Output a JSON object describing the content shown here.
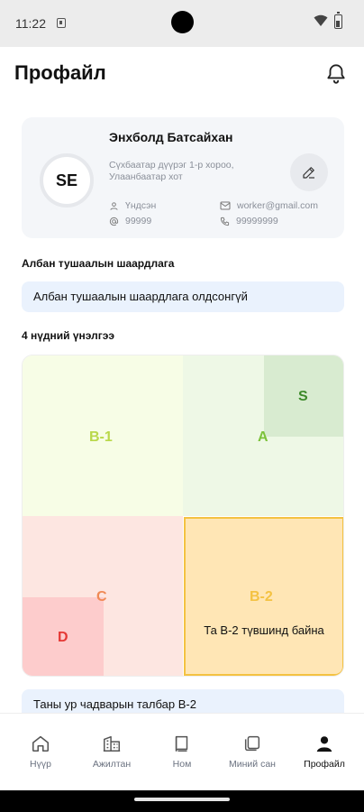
{
  "status_bar": {
    "time": "11:22"
  },
  "header": {
    "title": "Профайл"
  },
  "profile": {
    "initials": "SE",
    "name": "Энхболд Батсайхан",
    "address": "Сүхбаатар дүүрэг 1-р хороо, Улаанбаатар хот",
    "status": "Үндсэн",
    "email": "worker@gmail.com",
    "id_number": "99999",
    "phone": "99999999"
  },
  "requirements": {
    "title": "Албан тушаалын шаардлага",
    "empty_text": "Албан тушаалын шаардлага олдсонгүй"
  },
  "assessment": {
    "title": "4 нүдний үнэлгээ",
    "quadrants": {
      "b1": {
        "label": "B-1",
        "color": "#b9d84a"
      },
      "a": {
        "label": "A",
        "color": "#7cc23a"
      },
      "s": {
        "label": "S",
        "color": "#3d8a2a"
      },
      "c": {
        "label": "C",
        "color": "#f08a55"
      },
      "d": {
        "label": "D",
        "color": "#e53935"
      },
      "b2": {
        "label": "B-2",
        "color": "#f4c242"
      }
    },
    "current_text": "Та B-2 түвшинд байна"
  },
  "zone_text": "Таны ур чадварын талбар B-2",
  "bottom_nav": [
    {
      "label": "Нүүр",
      "icon": "home-icon"
    },
    {
      "label": "Ажилтан",
      "icon": "building-icon"
    },
    {
      "label": "Ном",
      "icon": "book-icon"
    },
    {
      "label": "Миний сан",
      "icon": "wallet-icon"
    },
    {
      "label": "Профайл",
      "icon": "person-icon",
      "active": true
    }
  ]
}
